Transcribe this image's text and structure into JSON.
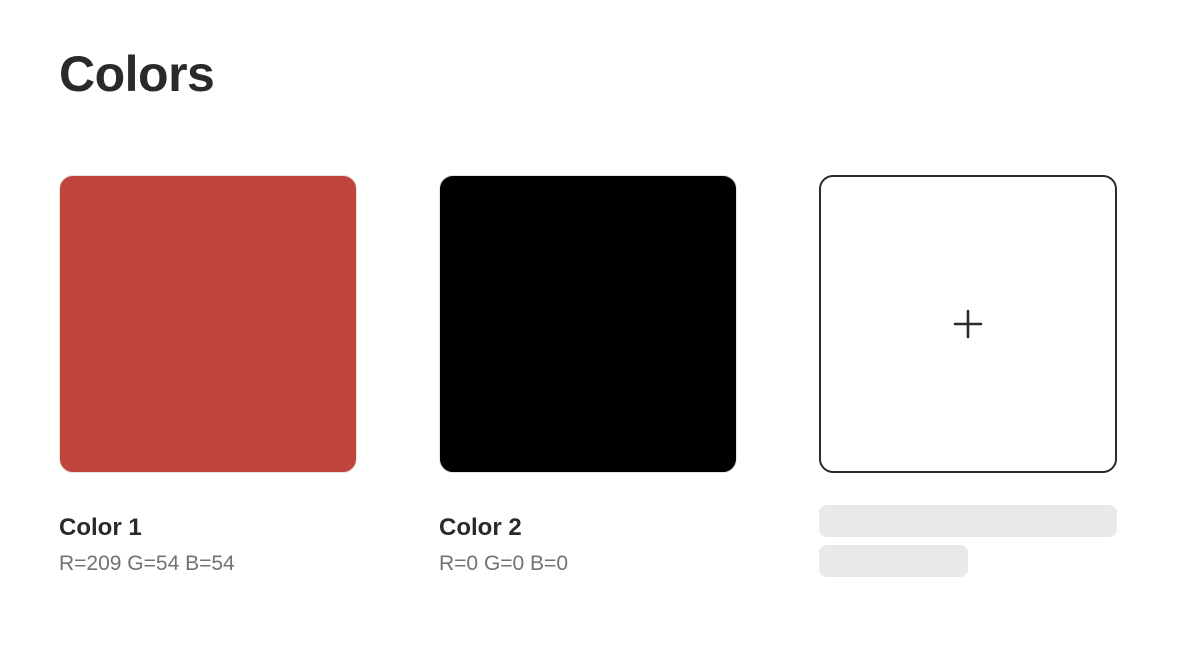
{
  "page": {
    "title": "Colors"
  },
  "swatches": [
    {
      "name": "Color 1",
      "rgb_text": "R=209 G=54 B=54",
      "color": "#c0463d"
    },
    {
      "name": "Color 2",
      "rgb_text": "R=0 G=0 B=0",
      "color": "#000000"
    }
  ],
  "add_tile": {
    "icon": "plus-icon"
  },
  "colors": {
    "text_primary": "#2a2a2a",
    "text_secondary": "#727272",
    "placeholder": "#e9e9e9"
  }
}
